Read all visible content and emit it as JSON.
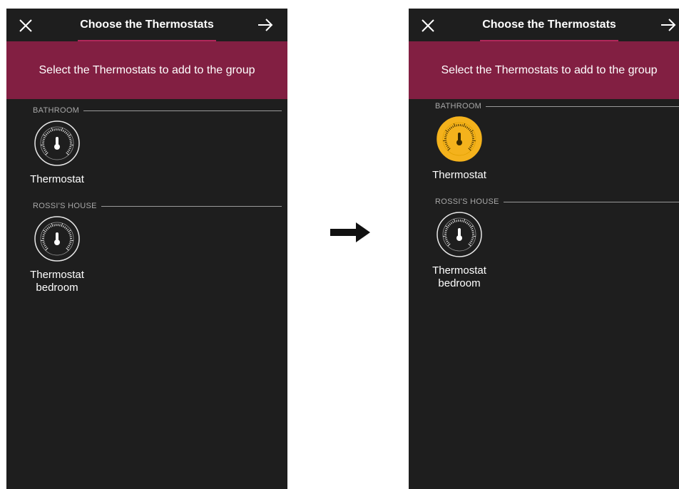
{
  "screens": [
    {
      "title": "Choose the Thermostats",
      "banner": "Select the Thermostats to add to the group",
      "sections": [
        {
          "label": "BATHROOM",
          "devices": [
            {
              "label": "Thermostat",
              "selected": false
            }
          ]
        },
        {
          "label": "ROSSI'S HOUSE",
          "devices": [
            {
              "label": "Thermostat bedroom",
              "selected": false
            }
          ]
        }
      ]
    },
    {
      "title": "Choose the Thermostats",
      "banner": "Select the Thermostats to add to the group",
      "sections": [
        {
          "label": "BATHROOM",
          "devices": [
            {
              "label": "Thermostat",
              "selected": true
            }
          ]
        },
        {
          "label": "ROSSI'S HOUSE",
          "devices": [
            {
              "label": "Thermostat bedroom",
              "selected": false
            }
          ]
        }
      ]
    }
  ],
  "icons": {
    "close": "close-icon",
    "next": "arrow-right-icon",
    "device": "thermostat-icon",
    "transition": "right-arrow-icon"
  },
  "colors": {
    "header": "#1e1e1e",
    "banner": "#821f42",
    "accent": "#b0285a",
    "selected": "#f4b21c"
  }
}
